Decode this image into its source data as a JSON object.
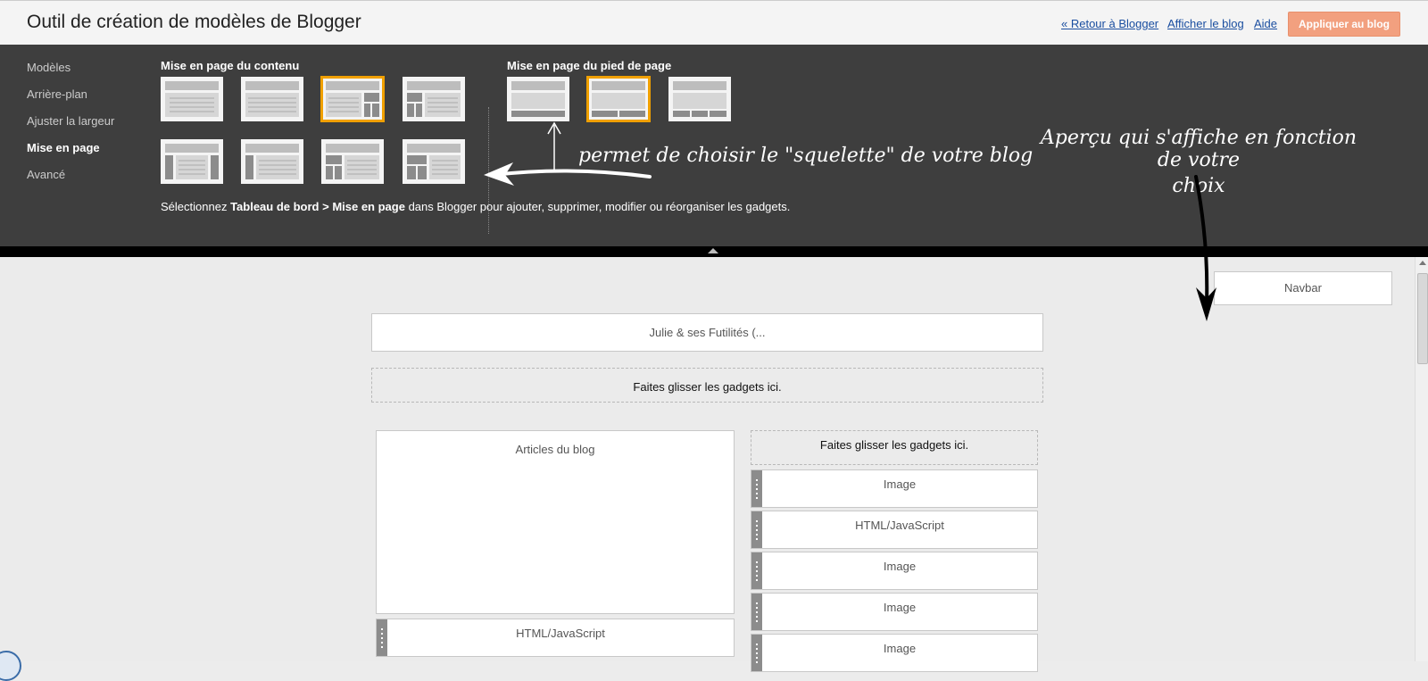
{
  "header": {
    "title": "Outil de création de modèles de Blogger",
    "links": {
      "back": "« Retour à Blogger",
      "view": "Afficher le blog",
      "help": "Aide"
    },
    "apply_label": "Appliquer au blog"
  },
  "sidebar": {
    "items": [
      {
        "label": "Modèles"
      },
      {
        "label": "Arrière-plan"
      },
      {
        "label": "Ajuster la largeur"
      },
      {
        "label": "Mise en page",
        "active": true
      },
      {
        "label": "Avancé"
      }
    ]
  },
  "layout_panel": {
    "content_title": "Mise en page du contenu",
    "footer_title": "Mise en page du pied de page",
    "hint_prefix": "Sélectionnez ",
    "hint_bold": "Tableau de bord > Mise en page",
    "hint_suffix": " dans Blogger pour ajouter, supprimer, modifier ou réorganiser les gadgets.",
    "selected_content_layout": 3,
    "selected_footer_layout": 2
  },
  "annotations": {
    "skeleton": "permet de choisir le \"squelette\" de votre blog",
    "preview_line1": "Aperçu qui s'affiche en fonction de votre",
    "preview_line2": "choix"
  },
  "preview": {
    "navbar": "Navbar",
    "header_gadget": "Julie & ses Futilités (...",
    "drop_here": "Faites glisser les gadgets ici.",
    "main_column": {
      "posts": "Articles du blog",
      "html_js": "HTML/JavaScript"
    },
    "sidebar_column": {
      "drop_here": "Faites glisser les gadgets ici.",
      "gadgets": [
        "Image",
        "HTML/JavaScript",
        "Image",
        "Image",
        "Image"
      ]
    }
  },
  "colors": {
    "panel_bg": "#3e3e3e",
    "selected_border": "#f0a000",
    "apply_button": "#f2a07f",
    "link": "#1a4ea0"
  }
}
